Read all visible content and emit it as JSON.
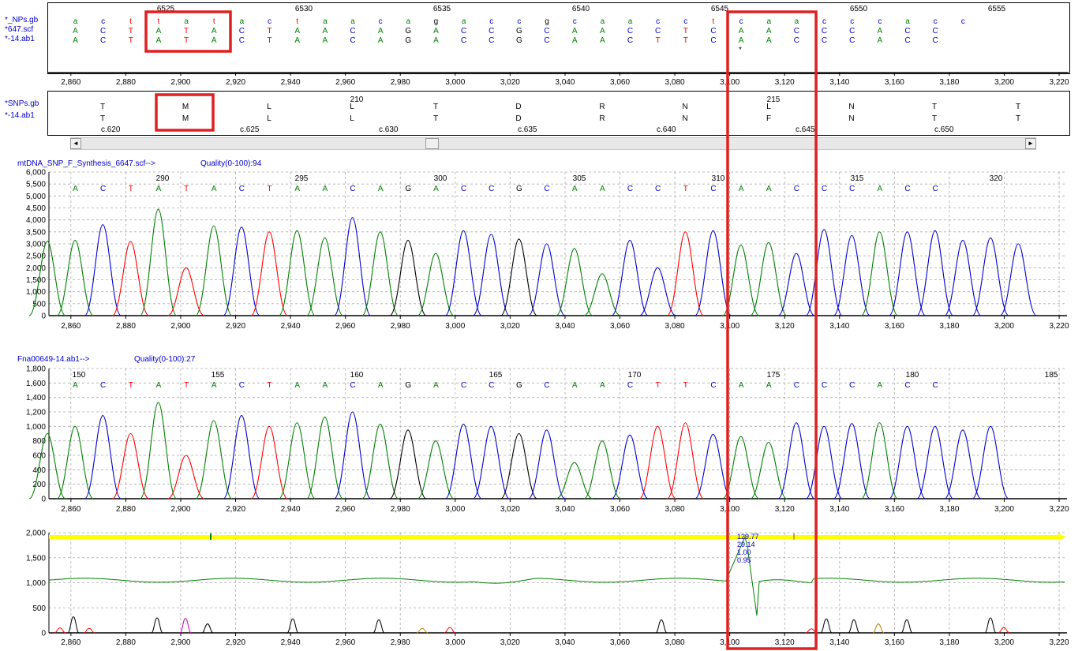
{
  "alignment": {
    "row_labels": [
      "*_NPs.gb",
      "*647.scf",
      "*-14.ab1"
    ],
    "ref_positions": [
      {
        "label": "6525",
        "x": 210
      },
      {
        "label": "6530",
        "x": 385
      },
      {
        "label": "6535",
        "x": 560
      },
      {
        "label": "6540",
        "x": 736
      },
      {
        "label": "6545",
        "x": 912
      },
      {
        "label": "6550",
        "x": 1088
      },
      {
        "label": "6555",
        "x": 1263
      }
    ],
    "row1": "acttatactaacagaccgcaacctcaacccacc",
    "row2": "ACTATACTAACAGACCGCAACCTCAACCCACC",
    "row3": "ACTATACTAACAGACCGCAACTTCAACCCACC",
    "mismatch_marker": "*"
  },
  "protein": {
    "row_labels": [
      "*SNPs.gb",
      "*-14.ab1"
    ],
    "pos_labels": [
      {
        "label": "210",
        "x": 452
      },
      {
        "label": "215",
        "x": 980
      }
    ],
    "row1": [
      "T",
      "M",
      "L",
      "L",
      "T",
      "D",
      "R",
      "N",
      "L",
      "N",
      "T",
      "T"
    ],
    "row2": [
      "T",
      "M",
      "L",
      "L",
      "T",
      "D",
      "R",
      "N",
      "F",
      "N",
      "T",
      "T"
    ],
    "codon_labels": [
      "c.620",
      "c.625",
      "c.630",
      "c.635",
      "c.640",
      "c.645",
      "c.650"
    ]
  },
  "trace1": {
    "title": "mtDNA_SNP_F_Synthesis_6647.scf-->",
    "quality": "Quality(0-100):94",
    "seq": "ACTATACTAACAGACCGCAACCTCAACCCACC",
    "pos_labels": [
      "290",
      "295",
      "300",
      "305",
      "310",
      "315",
      "320"
    ],
    "y_ticks": [
      "0",
      "500",
      "1,000",
      "1,500",
      "2,000",
      "2,500",
      "3,000",
      "3,500",
      "4,000",
      "4,500",
      "5,000",
      "5,500",
      "6,000"
    ],
    "peaks": [
      3100,
      3150,
      3800,
      3100,
      4450,
      2000,
      3750,
      3700,
      3500,
      3550,
      3250,
      4100,
      3500,
      3150,
      2600,
      3550,
      3400,
      3200,
      3000,
      2800,
      1750,
      3150,
      2000,
      3500,
      3550,
      2950,
      3050,
      2600,
      3600,
      3350,
      3500,
      3500,
      3550,
      3150,
      3250,
      3000
    ]
  },
  "trace2": {
    "title": "Fna00649-14.ab1-->",
    "quality": "Quality(0-100):27",
    "seq": "ACTATACTAACAGACCGCAACTTCAACCCACC",
    "pos_labels": [
      "150",
      "155",
      "160",
      "165",
      "170",
      "175",
      "180",
      "185"
    ],
    "y_ticks": [
      "0",
      "200",
      "400",
      "600",
      "800",
      "1,000",
      "1,200",
      "1,400",
      "1,600",
      "1,800"
    ],
    "peaks": [
      900,
      1000,
      1150,
      900,
      1330,
      600,
      1080,
      1150,
      1000,
      1050,
      1130,
      1200,
      1030,
      950,
      800,
      1030,
      1000,
      900,
      950,
      500,
      800,
      880,
      1000,
      1050,
      890,
      860,
      780,
      1050,
      1000,
      1040,
      1050,
      1000,
      1000,
      950,
      1000
    ]
  },
  "quality_chart": {
    "y_ticks": [
      "0",
      "500",
      "1,000",
      "1,500",
      "2,000"
    ],
    "annotations": [
      "129.77",
      "29.14",
      "1.00",
      "0.95"
    ]
  },
  "x_axis_labels": [
    "2,860",
    "2,880",
    "2,900",
    "2,920",
    "2,940",
    "2,960",
    "2,980",
    "3,000",
    "3,020",
    "3,040",
    "3,060",
    "3,080",
    "3,100",
    "3,120",
    "3,140",
    "3,160",
    "3,180",
    "3,200",
    "3,220"
  ],
  "colors": {
    "A": "#008000",
    "C": "#0000cc",
    "T": "#ff0000",
    "G": "#000000",
    "highlight": "#e02020",
    "label": "#0000cc",
    "quality_bar": "#ffff00"
  },
  "scrollbar": {
    "left": "◄",
    "right": "►"
  }
}
